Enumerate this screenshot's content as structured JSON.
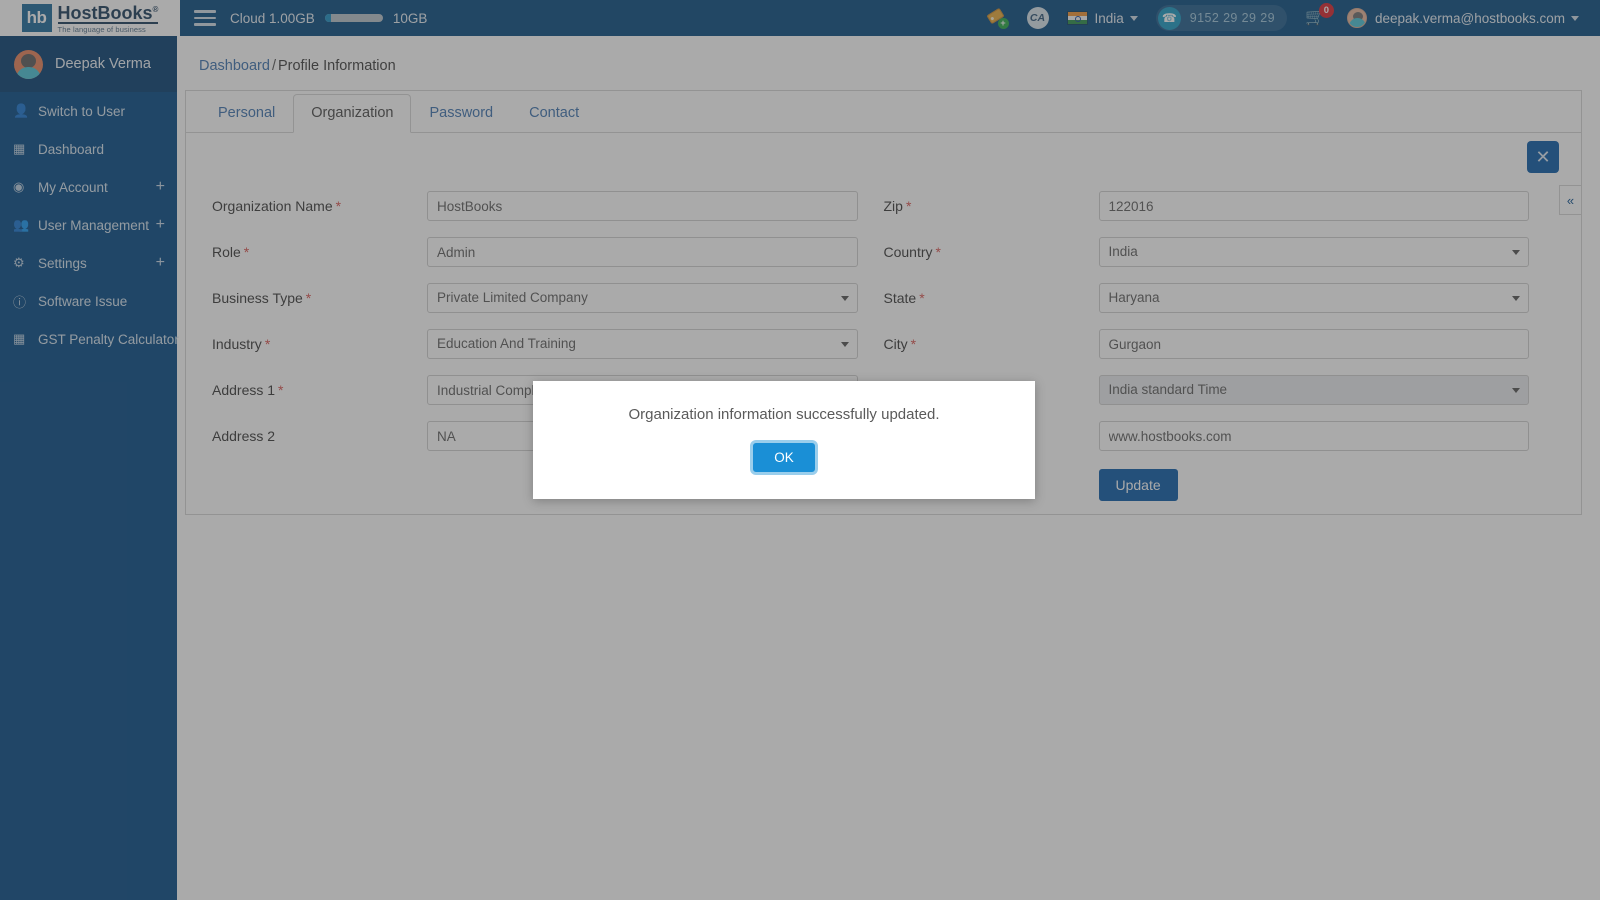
{
  "header": {
    "logo": {
      "mark": "hb",
      "name": "HostBooks",
      "registered": "®",
      "tagline": "The language of business"
    },
    "menu_icon": "hamburger-icon",
    "cloud_used_label": "Cloud 1.00GB",
    "cloud_total_label": "10GB",
    "cloud_used_percent": 10,
    "offer_icon": "tag-plus-icon",
    "ca_icon_label": "CA",
    "country": "India",
    "country_flag": "india-flag-icon",
    "support_phone": "9152 29 29 29",
    "support_icon": "headset-icon",
    "cart_icon": "cart-icon",
    "cart_count": "0",
    "user_email": "deepak.verma@hostbooks.com",
    "user_avatar": "user-avatar-icon",
    "caret": "▾"
  },
  "sidebar": {
    "profile_name": "Deepak Verma",
    "profile_avatar": "user-avatar-icon",
    "items": [
      {
        "label": "Switch to User",
        "icon": "user-icon",
        "expandable": false
      },
      {
        "label": "Dashboard",
        "icon": "dashboard-icon",
        "expandable": false
      },
      {
        "label": "My Account",
        "icon": "account-circle-icon",
        "expandable": true,
        "plus": "+"
      },
      {
        "label": "User Management",
        "icon": "users-group-icon",
        "expandable": true,
        "plus": "+"
      },
      {
        "label": "Settings",
        "icon": "gear-icon",
        "expandable": true,
        "plus": "+"
      },
      {
        "label": "Software Issue",
        "icon": "info-icon",
        "expandable": false
      },
      {
        "label": "GST Penalty Calculator",
        "icon": "calculator-icon",
        "expandable": false
      }
    ]
  },
  "breadcrumb": {
    "root": "Dashboard",
    "separator": "/",
    "current": "Profile Information"
  },
  "tabs": [
    {
      "label": "Personal",
      "active": false
    },
    {
      "label": "Organization",
      "active": true
    },
    {
      "label": "Password",
      "active": false
    },
    {
      "label": "Contact",
      "active": false
    }
  ],
  "form": {
    "close_icon": "close-icon",
    "left_fields": [
      {
        "label": "Organization Name",
        "required": true,
        "type": "text",
        "value": "HostBooks"
      },
      {
        "label": "Role",
        "required": true,
        "type": "text",
        "value": "Admin"
      },
      {
        "label": "Business Type",
        "required": true,
        "type": "select",
        "value": "Private Limited Company"
      },
      {
        "label": "Industry",
        "required": true,
        "type": "select",
        "value": "Education And Training"
      },
      {
        "label": "Address 1",
        "required": true,
        "type": "text",
        "value": "Industrial Complex"
      },
      {
        "label": "Address 2",
        "required": false,
        "type": "text",
        "value": "NA"
      }
    ],
    "right_fields": [
      {
        "label": "Zip",
        "required": true,
        "type": "text",
        "value": "122016"
      },
      {
        "label": "Country",
        "required": true,
        "type": "select",
        "value": "India"
      },
      {
        "label": "State",
        "required": true,
        "type": "select",
        "value": "Haryana"
      },
      {
        "label": "City",
        "required": true,
        "type": "text",
        "value": "Gurgaon"
      },
      {
        "label": "",
        "required": false,
        "type": "select",
        "value": "India standard Time",
        "disabled": true
      },
      {
        "label": "",
        "required": false,
        "type": "text",
        "value": "www.hostbooks.com"
      }
    ],
    "update_label": "Update",
    "required_marker": "*"
  },
  "collapse_handle": {
    "icon": "chevron-double-left-icon",
    "glyph": "«"
  },
  "modal": {
    "message": "Organization information successfully updated.",
    "ok_label": "OK"
  },
  "colors": {
    "header_blue": "#084b80",
    "sidebar_blue": "#054a85",
    "primary_blue": "#0b5ba8",
    "link_blue": "#3e74b0",
    "modal_ok_blue": "#1a8fd6",
    "required_red": "#d9534f",
    "badge_red": "#d9232d",
    "overlay": "rgba(66,66,66,0.45)"
  }
}
